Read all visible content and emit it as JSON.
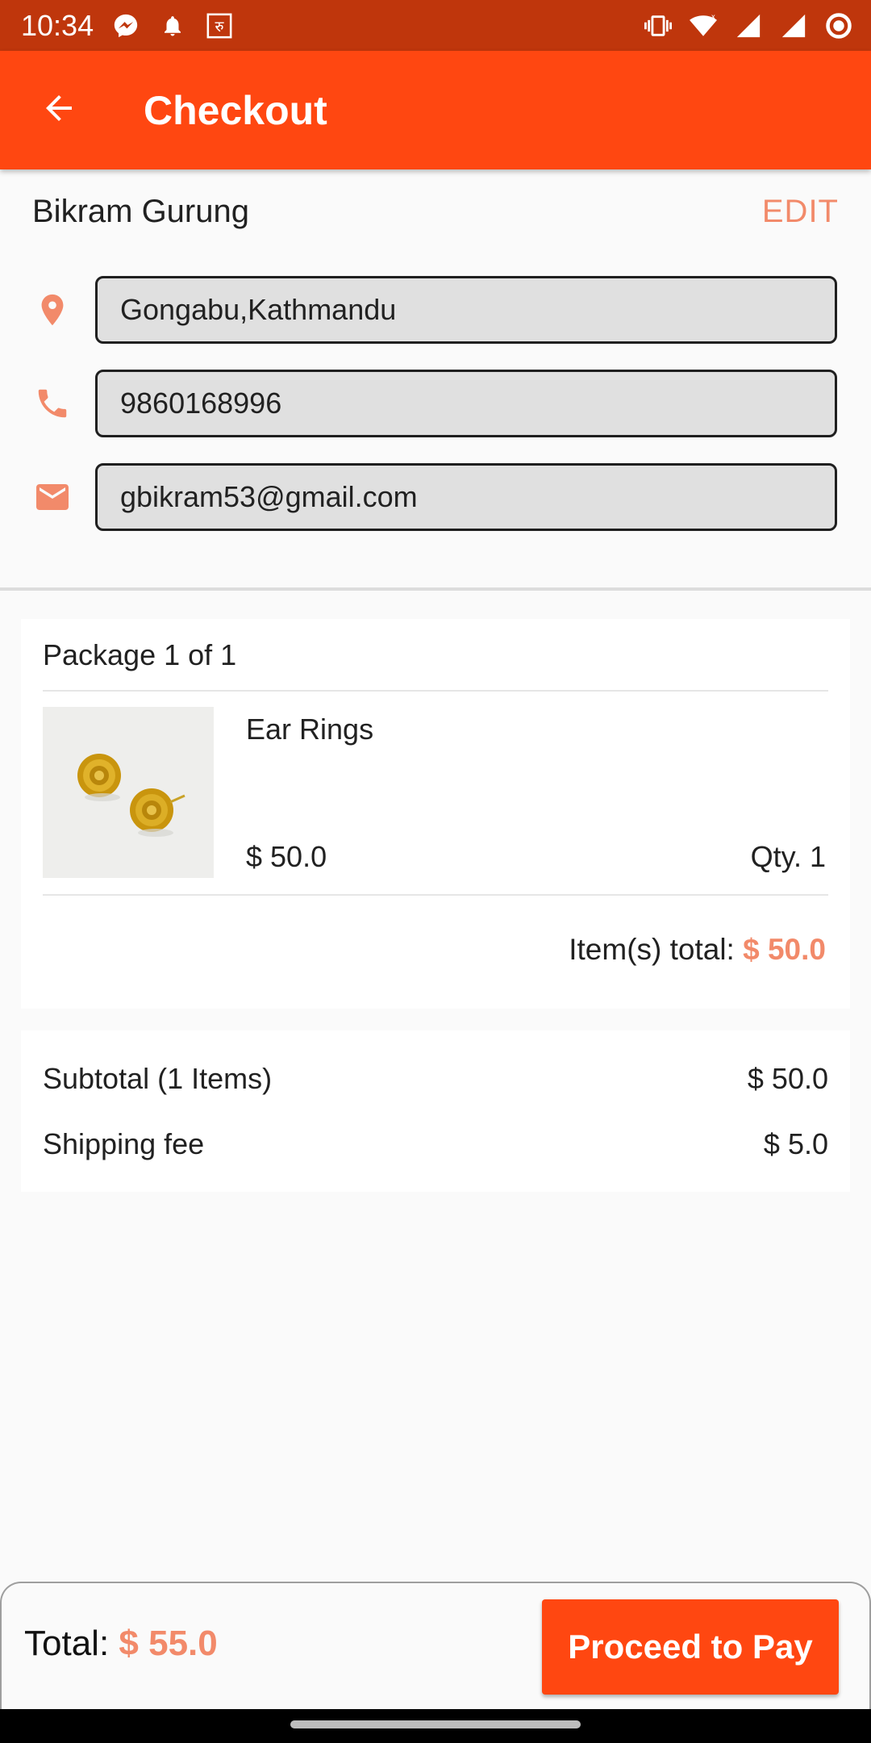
{
  "status_bar": {
    "time": "10:34",
    "icons": [
      "messenger-icon",
      "notification-bell-icon",
      "rupee-app-icon",
      "vibrate-icon",
      "wifi-icon",
      "signal-icon",
      "signal-icon-2",
      "record-icon"
    ]
  },
  "app_bar": {
    "title": "Checkout",
    "back_icon": "arrow-back-icon",
    "color": "#ff4711"
  },
  "user": {
    "name": "Bikram Gurung",
    "edit_label": "EDIT",
    "address": "Gongabu,Kathmandu",
    "phone": "9860168996",
    "email": "gbikram53@gmail.com"
  },
  "package": {
    "title": "Package 1 of 1",
    "items": [
      {
        "name": "Ear Rings",
        "price": "$ 50.0",
        "qty": "Qty. 1"
      }
    ],
    "items_total_label": "Item(s) total:",
    "items_total_value": "$ 50.0"
  },
  "summary": {
    "subtotal_label": "Subtotal (1 Items)",
    "subtotal_value": "$ 50.0",
    "shipping_label": "Shipping fee",
    "shipping_value": "$ 5.0"
  },
  "footer": {
    "total_label": "Total:",
    "total_value": "$ 55.0",
    "pay_button": "Proceed to Pay"
  },
  "colors": {
    "primary": "#ff4711",
    "status_bar": "#bf360c",
    "accent_text": "#f28a6a"
  }
}
